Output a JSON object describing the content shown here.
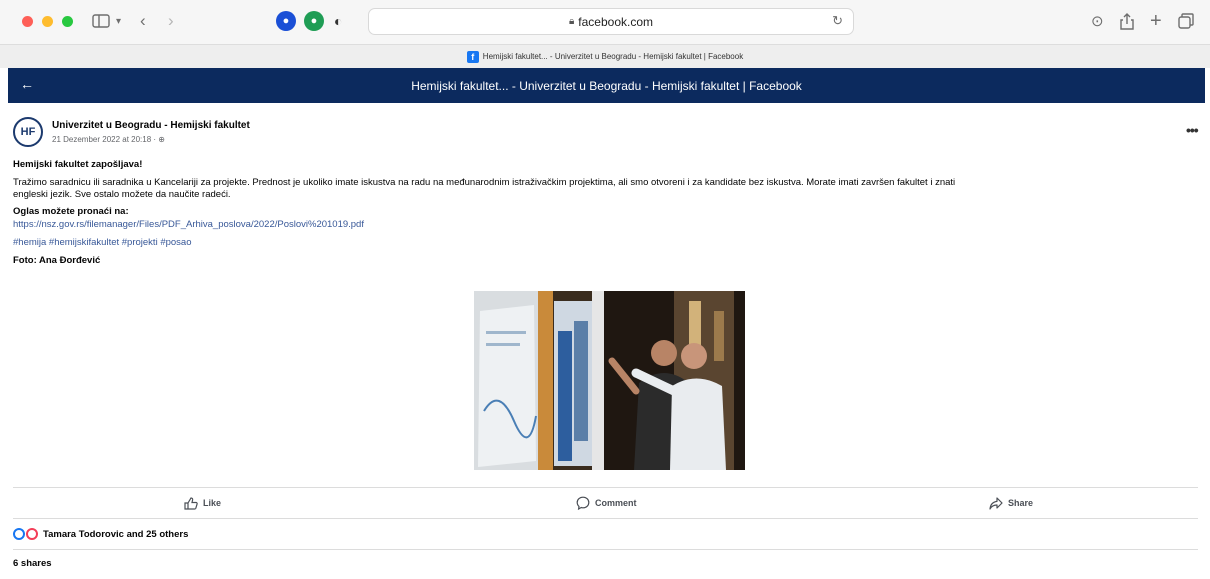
{
  "browser": {
    "url": "facebook.com",
    "tab_title": "Hemijski fakultet... - Univerzitet u Beogradu - Hemijski fakultet | Facebook"
  },
  "header": {
    "title": "Hemijski fakultet... - Univerzitet u Beogradu - Hemijski fakultet | Facebook"
  },
  "post": {
    "avatar_initials": "HF",
    "page_name": "Univerzitet u Beogradu - Hemijski fakultet",
    "date": "21 Dezember 2022 at 20:18 · ⊕",
    "headline": "Hemijski fakultet zapošljava!",
    "body_line1": "Tražimo saradnicu ili saradnika u Kancelariji za projekte. Prednost je ukoliko imate iskustva na radu na međunarodnim istraživačkim projektima, ali smo otvoreni i za kandidate bez iskustva. Morate imati završen fakultet i znati",
    "body_line2": "engleski jezik. Sve ostalo možete da naučite radeći.",
    "ad_label": "Oglas možete pronaći na:",
    "link": "https://nsz.gov.rs/filemanager/Files/PDF_Arhiva_poslova/2022/Poslovi%201019.pdf",
    "hashtags": "#hemija #hemijskifakultet #projekti #posao",
    "photo_credit": "Foto: Ana Đorđević"
  },
  "actions": {
    "like": "Like",
    "comment": "Comment",
    "share": "Share"
  },
  "engagement": {
    "reactions": "Tamara Todorovic and 25 others",
    "shares": "6 shares"
  },
  "colors": {
    "header_band": "#0c2a5e",
    "link": "#385898"
  }
}
